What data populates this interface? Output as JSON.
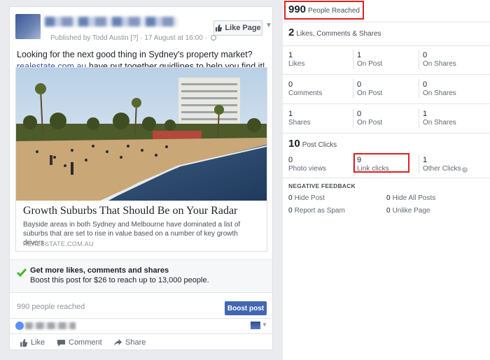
{
  "post": {
    "meta": "Published by Todd Austin",
    "meta_extra": " [?] · 17 August at 16:00 · ",
    "like_page_label": "Like Page",
    "text_line1": "Looking for the next good thing in Sydney's property market?",
    "text_link": "realestate.com.au",
    "text_line2": " have put together guidlines to help you find it!",
    "attachment": {
      "title": "Growth Suburbs That Should Be on Your Radar",
      "description": "Bayside areas in both Sydney and Melbourne have dominated a list of suburbs that are set to rise in value based on a number of key growth drivers.",
      "domain": "REALESTATE.COM.AU"
    },
    "promo": {
      "title": "Get more likes, comments and shares",
      "subtitle": "Boost this post for $26 to reach up to 13,000 people."
    },
    "reach_text": "990 people reached",
    "boost_label": "Boost post",
    "actions": {
      "like": "Like",
      "comment": "Comment",
      "share": "Share"
    }
  },
  "insights": {
    "reached": {
      "value": "990",
      "label": "People Reached"
    },
    "engagement": {
      "value": "2",
      "label": "Likes, Comments & Shares"
    },
    "rows": [
      [
        {
          "n": "1",
          "l": "Likes"
        },
        {
          "n": "1",
          "l": "On Post"
        },
        {
          "n": "0",
          "l": "On Shares"
        }
      ],
      [
        {
          "n": "0",
          "l": "Comments"
        },
        {
          "n": "0",
          "l": "On Post"
        },
        {
          "n": "0",
          "l": "On Shares"
        }
      ],
      [
        {
          "n": "1",
          "l": "Shares"
        },
        {
          "n": "0",
          "l": "On Post"
        },
        {
          "n": "1",
          "l": "On Shares"
        }
      ]
    ],
    "clicks": {
      "value": "10",
      "label": "Post Clicks",
      "cells": [
        {
          "n": "0",
          "l": "Photo views"
        },
        {
          "n": "9",
          "l": "Link clicks"
        },
        {
          "n": "1",
          "l": "Other Clicks"
        }
      ]
    },
    "negative": {
      "title": "NEGATIVE FEEDBACK",
      "items": [
        {
          "n": "0",
          "l": "Hide Post"
        },
        {
          "n": "0",
          "l": "Hide All Posts"
        },
        {
          "n": "0",
          "l": "Report as Spam"
        },
        {
          "n": "0",
          "l": "Unlike Page"
        }
      ]
    }
  },
  "colors": {
    "fb_blue": "#4267b2",
    "link_blue": "#365899",
    "highlight_red": "#e02020",
    "check_green": "#42b72a"
  }
}
